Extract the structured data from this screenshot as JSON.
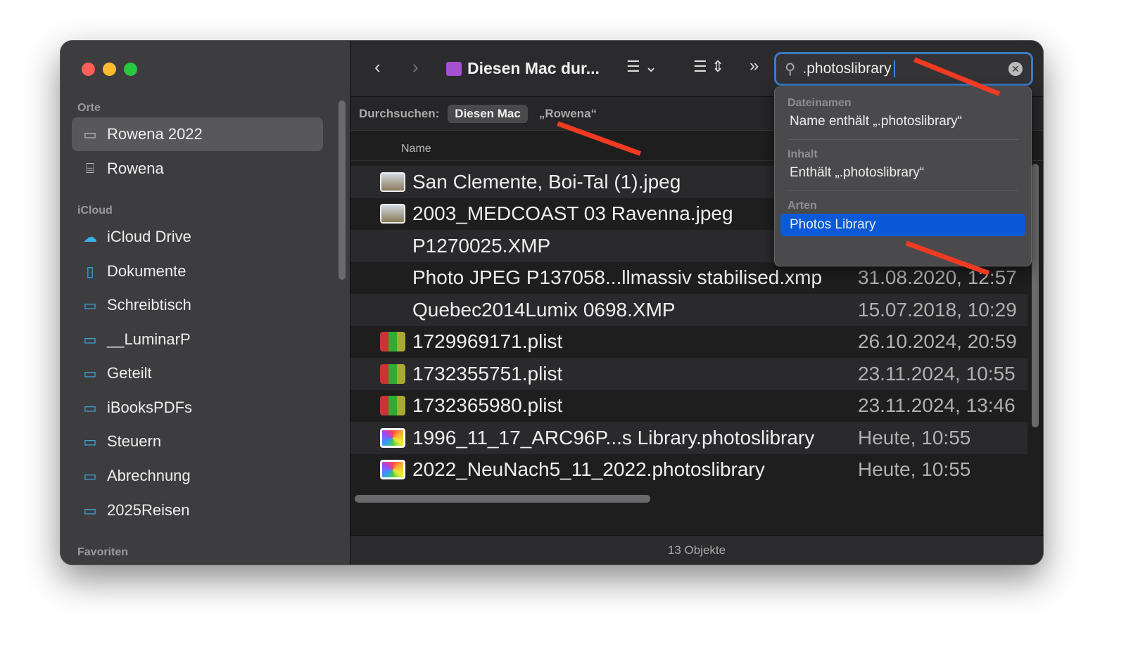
{
  "sidebar": {
    "sections": [
      "Orte",
      "iCloud",
      "Favoriten"
    ],
    "items": [
      {
        "label": "Rowena 2022",
        "icon": "laptop-icon"
      },
      {
        "label": "Rowena",
        "icon": "drive-icon"
      },
      {
        "label": "iCloud Drive",
        "icon": "cloud-icon"
      },
      {
        "label": "Dokumente",
        "icon": "document-icon"
      },
      {
        "label": "Schreibtisch",
        "icon": "desktop-icon"
      },
      {
        "label": "__LuminarP",
        "icon": "folder-icon"
      },
      {
        "label": "Geteilt",
        "icon": "shared-folder-icon"
      },
      {
        "label": "iBooksPDFs",
        "icon": "folder-icon"
      },
      {
        "label": "Steuern",
        "icon": "folder-icon"
      },
      {
        "label": "Abrechnung",
        "icon": "folder-icon"
      },
      {
        "label": "2025Reisen",
        "icon": "folder-icon"
      }
    ]
  },
  "toolbar": {
    "title": "Diesen Mac dur...",
    "search_value": ".photoslibrary"
  },
  "scope": {
    "label": "Durchsuchen:",
    "this_mac": "Diesen Mac",
    "rowena": "„Rowena“"
  },
  "columns": {
    "name": "Name"
  },
  "files": [
    {
      "name": "San Clemente, Boi-Tal (1).jpeg",
      "date": "",
      "icon": "jpeg"
    },
    {
      "name": "2003_MEDCOAST 03 Ravenna.jpeg",
      "date": "",
      "icon": "jpeg"
    },
    {
      "name": "P1270025.XMP",
      "date": "",
      "icon": "none"
    },
    {
      "name": "Photo JPEG P137058...llmassiv stabilised.xmp",
      "date": "31.08.2020, 12:57",
      "icon": "none"
    },
    {
      "name": "Quebec2014Lumix 0698.XMP",
      "date": "15.07.2018, 10:29",
      "icon": "none"
    },
    {
      "name": "1729969171.plist",
      "date": "26.10.2024, 20:59",
      "icon": "plist"
    },
    {
      "name": "1732355751.plist",
      "date": "23.11.2024, 10:55",
      "icon": "plist"
    },
    {
      "name": "1732365980.plist",
      "date": "23.11.2024, 13:46",
      "icon": "plist"
    },
    {
      "name": "1996_11_17_ARC96P...s Library.photoslibrary",
      "date": "Heute, 10:55",
      "icon": "photos"
    },
    {
      "name": "2022_NeuNach5_11_2022.photoslibrary",
      "date": "Heute, 10:55",
      "icon": "photos"
    }
  ],
  "status": "13 Objekte",
  "dropdown": {
    "sections": [
      {
        "header": "Dateinamen",
        "item": "Name enthält „.photoslibrary“"
      },
      {
        "header": "Inhalt",
        "item": "Enthält „.photoslibrary“"
      },
      {
        "header": "Arten",
        "item": "Photos Library"
      }
    ]
  },
  "colors": {
    "accent": "#0a5ad8",
    "arrow": "#f03a22"
  }
}
